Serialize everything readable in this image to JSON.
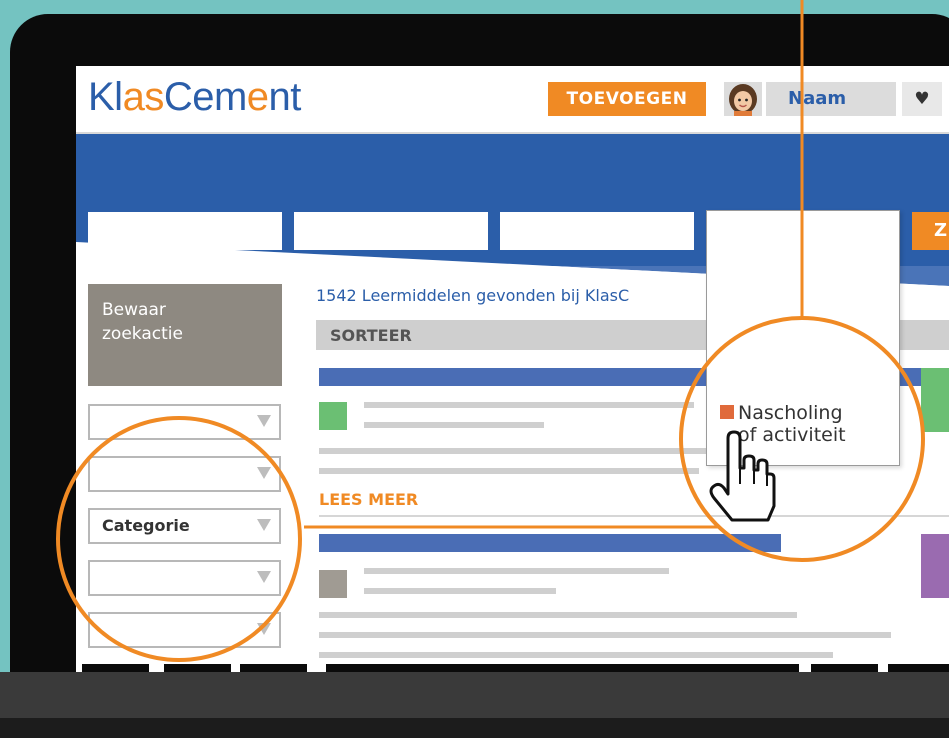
{
  "logo": {
    "part1": "Kl",
    "part2": "as",
    "part3": "Cem",
    "part4": "e",
    "part5": "nt"
  },
  "header": {
    "add_button": "TOEVOEGEN",
    "user_name": "Naam",
    "favorites_icon": "heart-icon"
  },
  "search": {
    "button_label": "Z"
  },
  "sidebar": {
    "save_search_line1": "Bewaar",
    "save_search_line2": "zoekactie",
    "filters": [
      "",
      "",
      "Categorie",
      "",
      ""
    ]
  },
  "results": {
    "count_text": "1542 Leermiddelen gevonden bij KlasC",
    "sort_label": "SORTEER",
    "read_more": "LEES MEER"
  },
  "dropdown": {
    "option_line1": "Nascholing",
    "option_line2": "of activiteit"
  },
  "colors": {
    "brand_blue": "#2b5ea9",
    "accent_orange": "#f08a24",
    "background_teal": "#74c3c1"
  }
}
